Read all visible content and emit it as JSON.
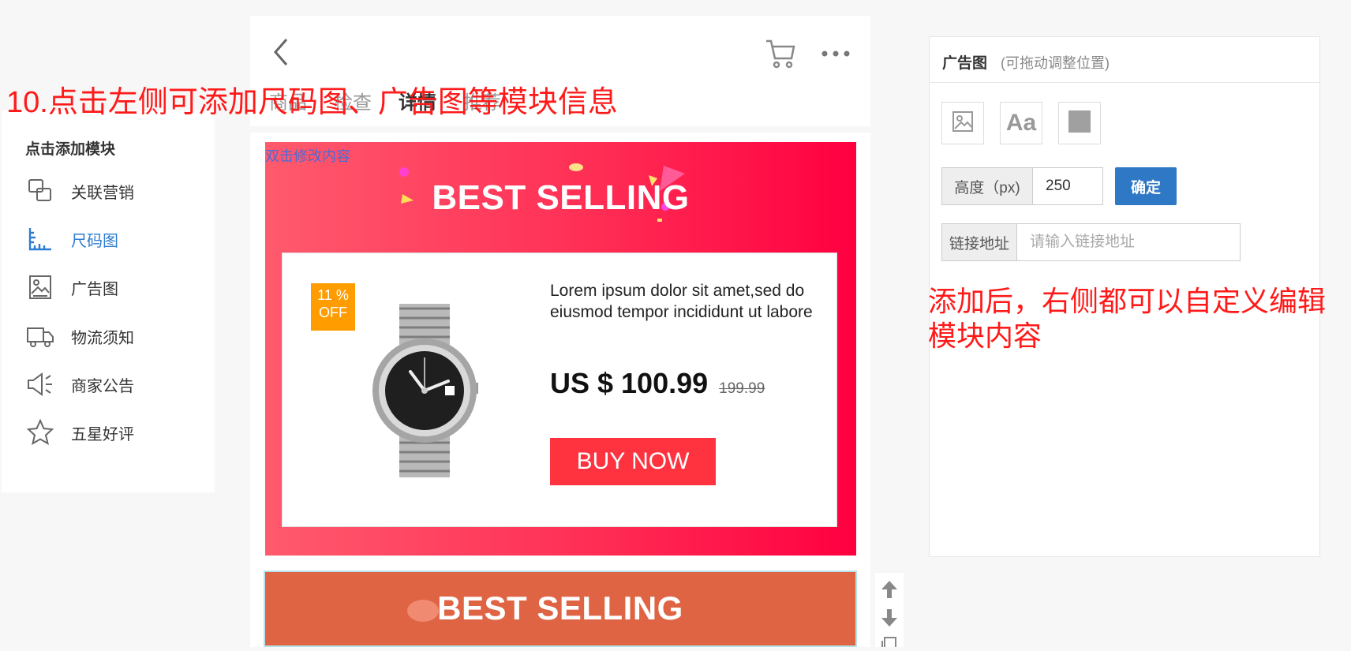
{
  "left_panel": {
    "title": "点击添加模块",
    "items": [
      {
        "label": "关联营销",
        "icon": "link-modules-icon"
      },
      {
        "label": "尺码图",
        "icon": "ruler-icon"
      },
      {
        "label": "广告图",
        "icon": "image-icon"
      },
      {
        "label": "物流须知",
        "icon": "truck-icon"
      },
      {
        "label": "商家公告",
        "icon": "megaphone-icon"
      },
      {
        "label": "五星好评",
        "icon": "star-icon"
      }
    ],
    "active_index": 1
  },
  "phone": {
    "tabs": [
      "商品",
      "检查",
      "详情",
      "推荐"
    ],
    "active_tab": "详情"
  },
  "banner1": {
    "edit_hint": "双击修改内容",
    "title": "BEST SELLING",
    "badge_line1": "11 %",
    "badge_line2": "OFF",
    "description": "Lorem ipsum dolor sit amet,sed do eiusmod tempor incididunt ut labore",
    "price": "US $ 100.99",
    "old_price": "199.99",
    "buy_label": "BUY NOW"
  },
  "banner2": {
    "title": "BEST SELLING"
  },
  "right_panel": {
    "title": "广告图",
    "subtitle": "(可拖动调整位置)",
    "height_label": "高度（px)",
    "height_value": "250",
    "confirm_label": "确定",
    "link_label": "链接地址",
    "link_placeholder": "请输入链接地址"
  },
  "annotations": {
    "left": "10.点击左侧可添加尺码图、广告图等模块信息",
    "right": "添加后，右侧都可以自定义编辑模块内容"
  },
  "colors": {
    "accent_blue": "#2e78c6",
    "annotation_red": "#ff1a1a",
    "banner_pink": "#ff2e55",
    "banner_orange": "#df6444",
    "buy_red": "#ff3340",
    "badge_orange": "#ff9c00"
  }
}
